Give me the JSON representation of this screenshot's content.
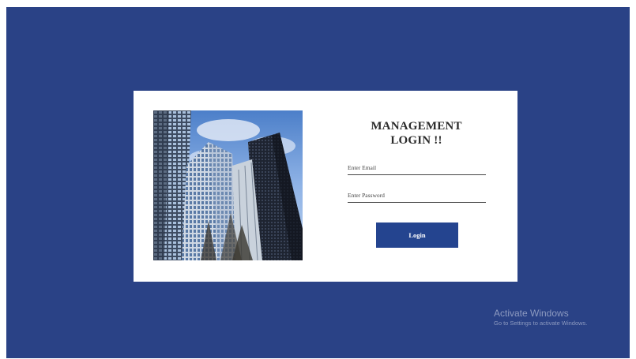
{
  "login_card": {
    "title_line1": "MANAGEMENT",
    "title_line2": "LOGIN !!",
    "email_placeholder": "Enter Email",
    "password_placeholder": "Enter Password",
    "login_label": "Login"
  },
  "watermark": {
    "title": "Activate Windows",
    "subtitle": "Go to Settings to activate Windows."
  },
  "colors": {
    "background": "#2a4286",
    "card": "#ffffff",
    "button": "#24448f"
  }
}
